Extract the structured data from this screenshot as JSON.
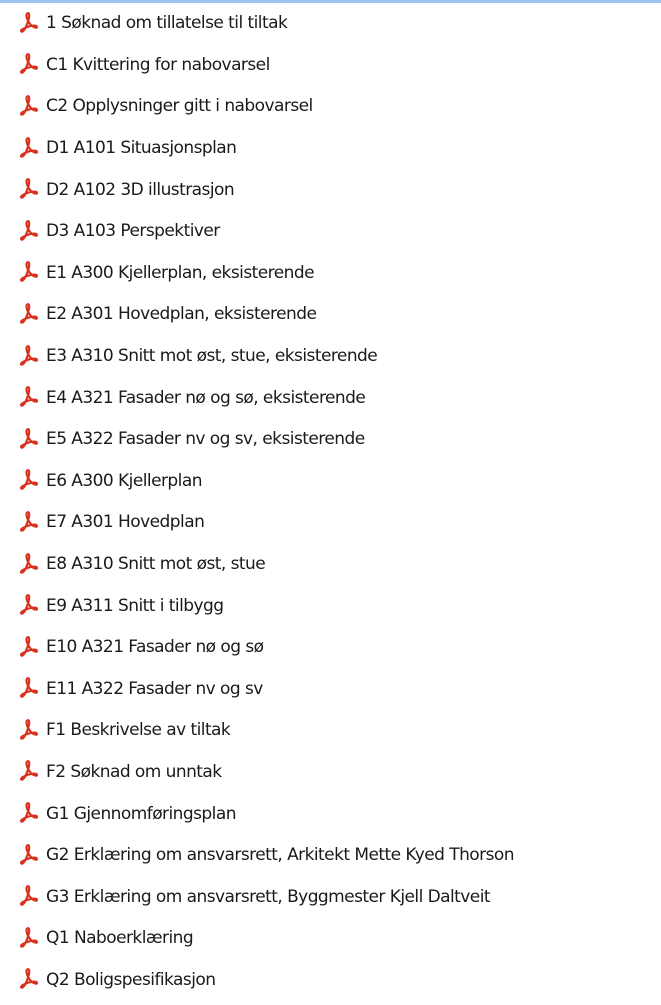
{
  "files": [
    {
      "name": "1 Søknad om tillatelse til tiltak",
      "icon": "pdf-icon"
    },
    {
      "name": "C1 Kvittering for nabovarsel",
      "icon": "pdf-icon"
    },
    {
      "name": "C2 Opplysninger gitt i nabovarsel",
      "icon": "pdf-icon"
    },
    {
      "name": "D1 A101 Situasjonsplan",
      "icon": "pdf-icon"
    },
    {
      "name": "D2 A102 3D illustrasjon",
      "icon": "pdf-icon"
    },
    {
      "name": "D3 A103 Perspektiver",
      "icon": "pdf-icon"
    },
    {
      "name": "E1 A300 Kjellerplan, eksisterende",
      "icon": "pdf-icon"
    },
    {
      "name": "E2 A301 Hovedplan, eksisterende",
      "icon": "pdf-icon"
    },
    {
      "name": "E3 A310 Snitt mot øst, stue, eksisterende",
      "icon": "pdf-icon"
    },
    {
      "name": "E4 A321 Fasader nø og sø, eksisterende",
      "icon": "pdf-icon"
    },
    {
      "name": "E5 A322 Fasader nv og sv, eksisterende",
      "icon": "pdf-icon"
    },
    {
      "name": "E6 A300 Kjellerplan",
      "icon": "pdf-icon"
    },
    {
      "name": "E7 A301 Hovedplan",
      "icon": "pdf-icon"
    },
    {
      "name": "E8 A310 Snitt mot øst, stue",
      "icon": "pdf-icon"
    },
    {
      "name": "E9 A311 Snitt i tilbygg",
      "icon": "pdf-icon"
    },
    {
      "name": "E10 A321 Fasader nø og sø",
      "icon": "pdf-icon"
    },
    {
      "name": "E11 A322 Fasader nv og sv",
      "icon": "pdf-icon"
    },
    {
      "name": "F1 Beskrivelse av tiltak",
      "icon": "pdf-icon"
    },
    {
      "name": "F2 Søknad om unntak",
      "icon": "pdf-icon"
    },
    {
      "name": "G1 Gjennomføringsplan",
      "icon": "pdf-icon"
    },
    {
      "name": "G2 Erklæring om ansvarsrett, Arkitekt Mette Kyed Thorson",
      "icon": "pdf-icon"
    },
    {
      "name": "G3 Erklæring om ansvarsrett, Byggmester Kjell Daltveit",
      "icon": "pdf-icon"
    },
    {
      "name": "Q1 Naboerklæring",
      "icon": "pdf-icon"
    },
    {
      "name": "Q2 Boligspesifikasjon",
      "icon": "pdf-icon"
    }
  ],
  "colors": {
    "icon_red": "#d8321f",
    "selection_border": "#9cc5ee",
    "text": "#1a1a1a"
  }
}
